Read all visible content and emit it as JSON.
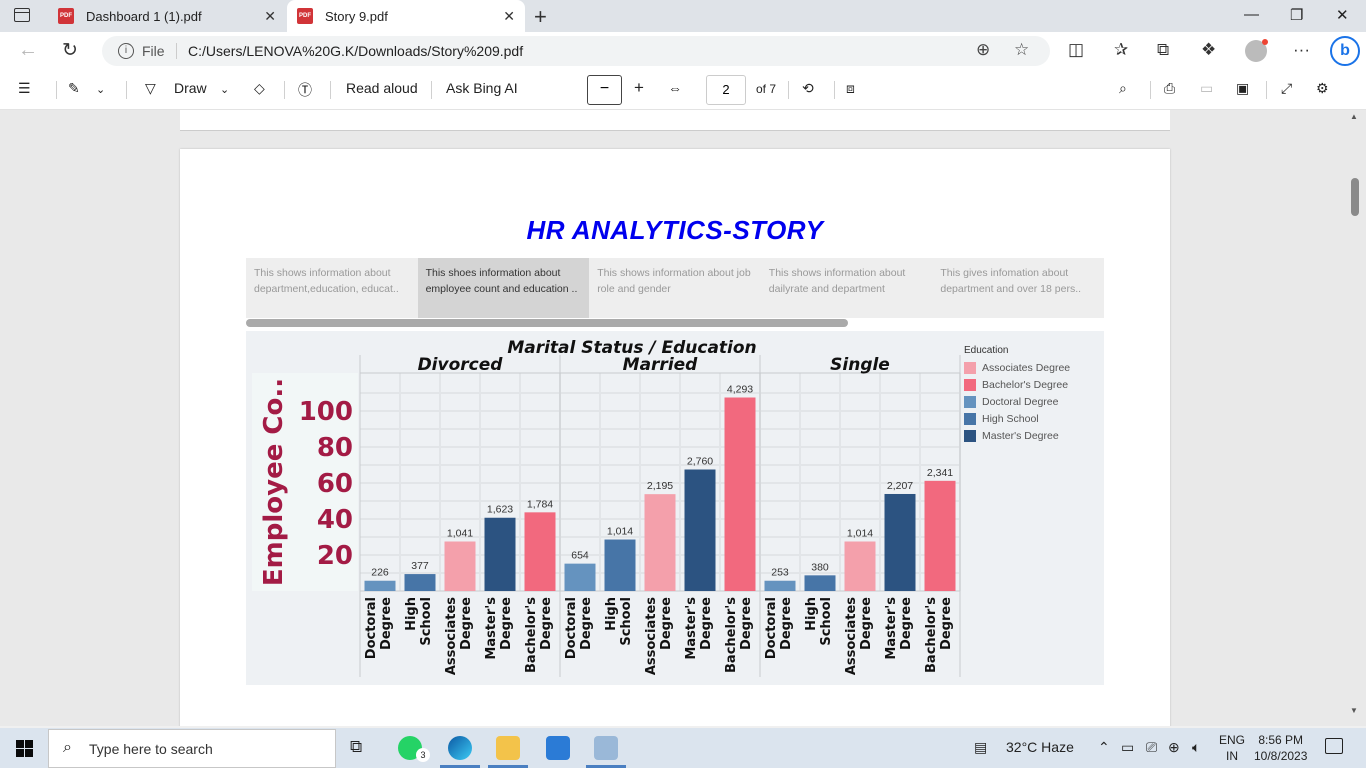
{
  "browser": {
    "tabs": [
      {
        "label": "Dashboard 1 (1).pdf",
        "active": false
      },
      {
        "label": "Story 9.pdf",
        "active": true
      }
    ],
    "url_prefix": "File",
    "url": "C:/Users/LENOVA%20G.K/Downloads/Story%209.pdf"
  },
  "pdf_toolbar": {
    "draw_label": "Draw",
    "read_aloud_label": "Read aloud",
    "ask_bing_label": "Ask Bing AI",
    "page_current": "2",
    "page_total": "of 7",
    "zoom_out_symbol": "−",
    "zoom_in_symbol": "+"
  },
  "story": {
    "title": "HR ANALYTICS-STORY",
    "points": [
      {
        "text": "This shows information about department,education, educat..",
        "selected": false
      },
      {
        "text": "This shoes information about employee count and education ..",
        "selected": true
      },
      {
        "text": "This shows information about job role and gender",
        "selected": false
      },
      {
        "text": "This shows information about dailyrate and department",
        "selected": false
      },
      {
        "text": "This gives infomation about department and over 18 pers..",
        "selected": false
      }
    ]
  },
  "chart_data": {
    "type": "bar",
    "title": "Marital Status  /  Education",
    "ylabel": "Employee Co..",
    "y_ticks": [
      20,
      40,
      60,
      80,
      100
    ],
    "legend_title": "Education",
    "legend": [
      {
        "name": "Associates Degree",
        "color": "#f4a0ab"
      },
      {
        "name": "Bachelor's Degree",
        "color": "#f2697e"
      },
      {
        "name": "Doctoral Degree",
        "color": "#6593bf"
      },
      {
        "name": "High School",
        "color": "#4775a7"
      },
      {
        "name": "Master's Degree",
        "color": "#2c5381"
      }
    ],
    "groups": [
      {
        "name": "Divorced",
        "bars": [
          {
            "category": "Doctoral Degree",
            "label": "226",
            "value": 5.7
          },
          {
            "category": "High School",
            "label": "377",
            "value": 9.4
          },
          {
            "category": "Associates Degree",
            "label": "1,041",
            "value": 27.5
          },
          {
            "category": "Master's Degree",
            "label": "1,623",
            "value": 40.7
          },
          {
            "category": "Bachelor's Degree",
            "label": "1,784",
            "value": 43.7
          }
        ]
      },
      {
        "name": "Married",
        "bars": [
          {
            "category": "Doctoral Degree",
            "label": "654",
            "value": 15.2
          },
          {
            "category": "High School",
            "label": "1,014",
            "value": 28.6
          },
          {
            "category": "Associates Degree",
            "label": "2,195",
            "value": 53.8
          },
          {
            "category": "Master's Degree",
            "label": "2,760",
            "value": 67.5
          },
          {
            "category": "Bachelor's Degree",
            "label": "4,293",
            "value": 107.5
          }
        ]
      },
      {
        "name": "Single",
        "bars": [
          {
            "category": "Doctoral Degree",
            "label": "253",
            "value": 5.7
          },
          {
            "category": "High School",
            "label": "380",
            "value": 8.7
          },
          {
            "category": "Associates Degree",
            "label": "1,014",
            "value": 27.5
          },
          {
            "category": "Master's Degree",
            "label": "2,207",
            "value": 53.9
          },
          {
            "category": "Bachelor's Degree",
            "label": "2,341",
            "value": 61.2
          }
        ]
      }
    ],
    "x_tick_labels": [
      [
        "Doctoral",
        "Degree"
      ],
      [
        "High",
        "School"
      ],
      [
        "Associates",
        "Degree"
      ],
      [
        "Master's",
        "Degree"
      ],
      [
        "Bachelor's",
        "Degree"
      ]
    ],
    "ylim": [
      0,
      110
    ]
  },
  "taskbar": {
    "search_placeholder": "Type here to search",
    "whatsapp_badge": "3",
    "weather": "32°C  Haze",
    "lang_line1": "ENG",
    "lang_line2": "IN",
    "time": "8:56 PM",
    "date": "10/8/2023"
  }
}
